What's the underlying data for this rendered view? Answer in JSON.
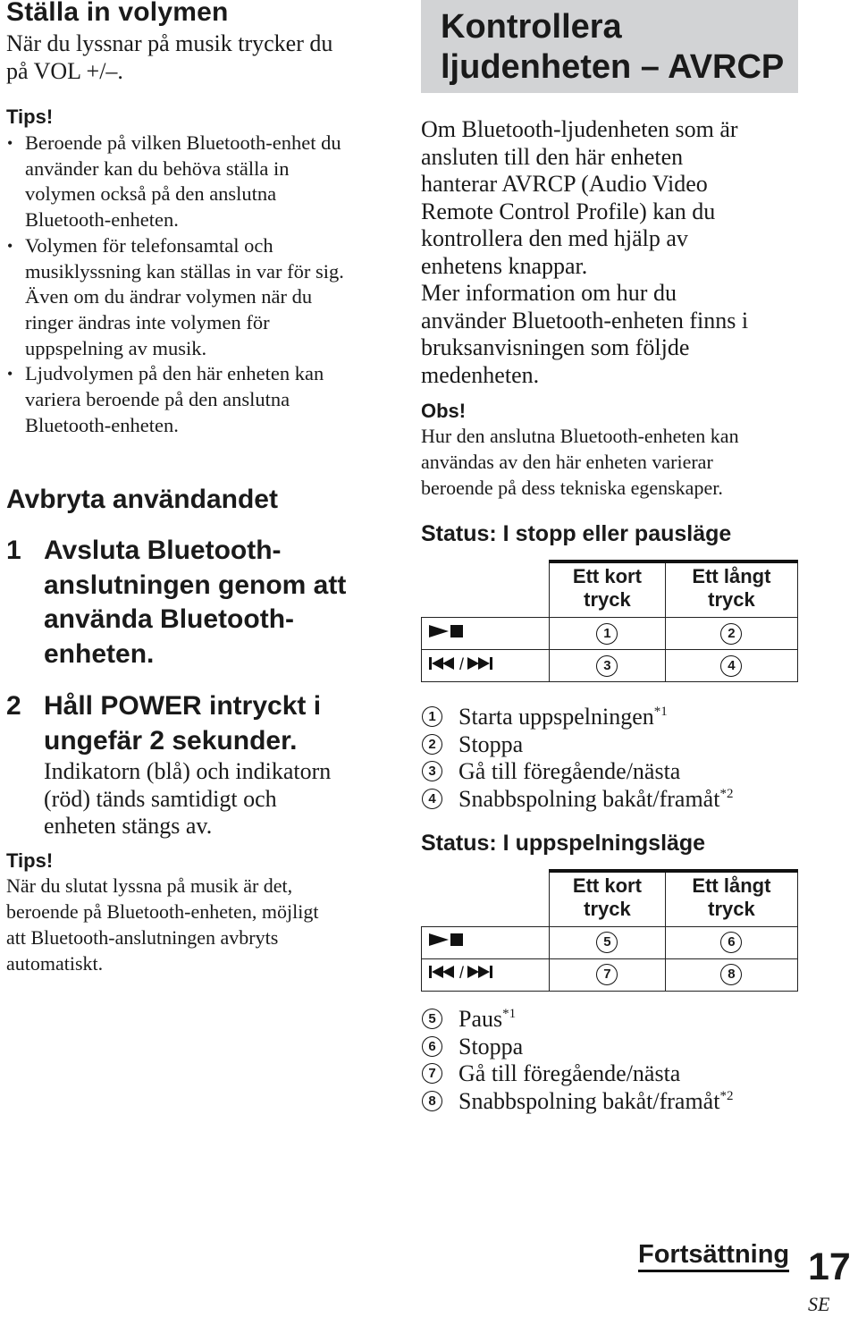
{
  "left": {
    "volume": {
      "title": "Ställa in volymen",
      "lead": [
        "När du lyssnar på musik trycker du",
        "på VOL +/–."
      ],
      "tips_heading": "Tips!",
      "tips": [
        [
          "Beroende på vilken Bluetooth-enhet du",
          "använder kan du behöva ställa in",
          "volymen också på den anslutna",
          "Bluetooth-enheten."
        ],
        [
          "Volymen för telefonsamtal och",
          "musiklyssning kan ställas in var för sig.",
          "Även om du ändrar volymen när du",
          "ringer ändras inte volymen för",
          "uppspelning av musik."
        ],
        [
          "Ljudvolymen på den här enheten kan",
          "variera beroende på den anslutna",
          "Bluetooth-enheten."
        ]
      ]
    },
    "cancel": {
      "title": "Avbryta användandet",
      "steps": [
        {
          "num": "1",
          "title": [
            "Avsluta Bluetooth-",
            "anslutningen genom att",
            "använda Bluetooth-",
            "enheten."
          ]
        },
        {
          "num": "2",
          "title": [
            "Håll POWER intryckt i",
            "ungefär 2 sekunder."
          ],
          "desc": [
            "Indikatorn (blå) och indikatorn",
            "(röd) tänds samtidigt och",
            "enheten stängs av."
          ]
        }
      ],
      "tips_heading": "Tips!",
      "tips_text": [
        "När du slutat lyssna på musik är det,",
        "beroende på Bluetooth-enheten, möjligt",
        "att Bluetooth-anslutningen avbryts",
        "automatiskt."
      ]
    }
  },
  "right": {
    "header": {
      "line1": "Kontrollera",
      "line2": "ljudenheten – AVRCP",
      "bg_color": "#d2d3d5"
    },
    "intro": [
      "Om Bluetooth-ljudenheten som är",
      "ansluten till den här enheten",
      "hanterar AVRCP (Audio Video",
      "Remote Control Profile) kan du",
      "kontrollera den med hjälp av",
      "enhetens knappar.",
      "Mer information om hur du",
      "använder Bluetooth-enheten finns i",
      "bruksanvisningen som följde",
      "medenheten."
    ],
    "note_heading": "Obs!",
    "note": [
      "Hur den anslutna Bluetooth-enheten kan",
      "användas av den här enheten varierar",
      "beroende på dess tekniska egenskaper."
    ],
    "tables": [
      {
        "status": "Status: I stopp eller pausläge",
        "col_short": [
          "Ett kort",
          "tryck"
        ],
        "col_long": [
          "Ett långt",
          "tryck"
        ],
        "rows": [
          {
            "keys": "play-stop",
            "short": "1",
            "long": "2"
          },
          {
            "keys": "prev-next",
            "short": "3",
            "long": "4"
          }
        ],
        "legend": [
          {
            "n": "1",
            "text": "Starta uppspelningen",
            "sup": "*1"
          },
          {
            "n": "2",
            "text": "Stoppa",
            "sup": ""
          },
          {
            "n": "3",
            "text": "Gå till föregående/nästa",
            "sup": ""
          },
          {
            "n": "4",
            "text": "Snabbspolning bakåt/framåt",
            "sup": "*2"
          }
        ]
      },
      {
        "status": "Status: I uppspelningsläge",
        "col_short": [
          "Ett kort",
          "tryck"
        ],
        "col_long": [
          "Ett långt",
          "tryck"
        ],
        "rows": [
          {
            "keys": "play-stop",
            "short": "5",
            "long": "6"
          },
          {
            "keys": "prev-next",
            "short": "7",
            "long": "8"
          }
        ],
        "legend": [
          {
            "n": "5",
            "text": "Paus",
            "sup": "*1"
          },
          {
            "n": "6",
            "text": "Stoppa",
            "sup": ""
          },
          {
            "n": "7",
            "text": "Gå till föregående/nästa",
            "sup": ""
          },
          {
            "n": "8",
            "text": "Snabbspolning bakåt/framåt",
            "sup": "*2"
          }
        ]
      }
    ]
  },
  "footer": {
    "continued": "Fortsättning",
    "page": "17",
    "lang": "SE"
  }
}
